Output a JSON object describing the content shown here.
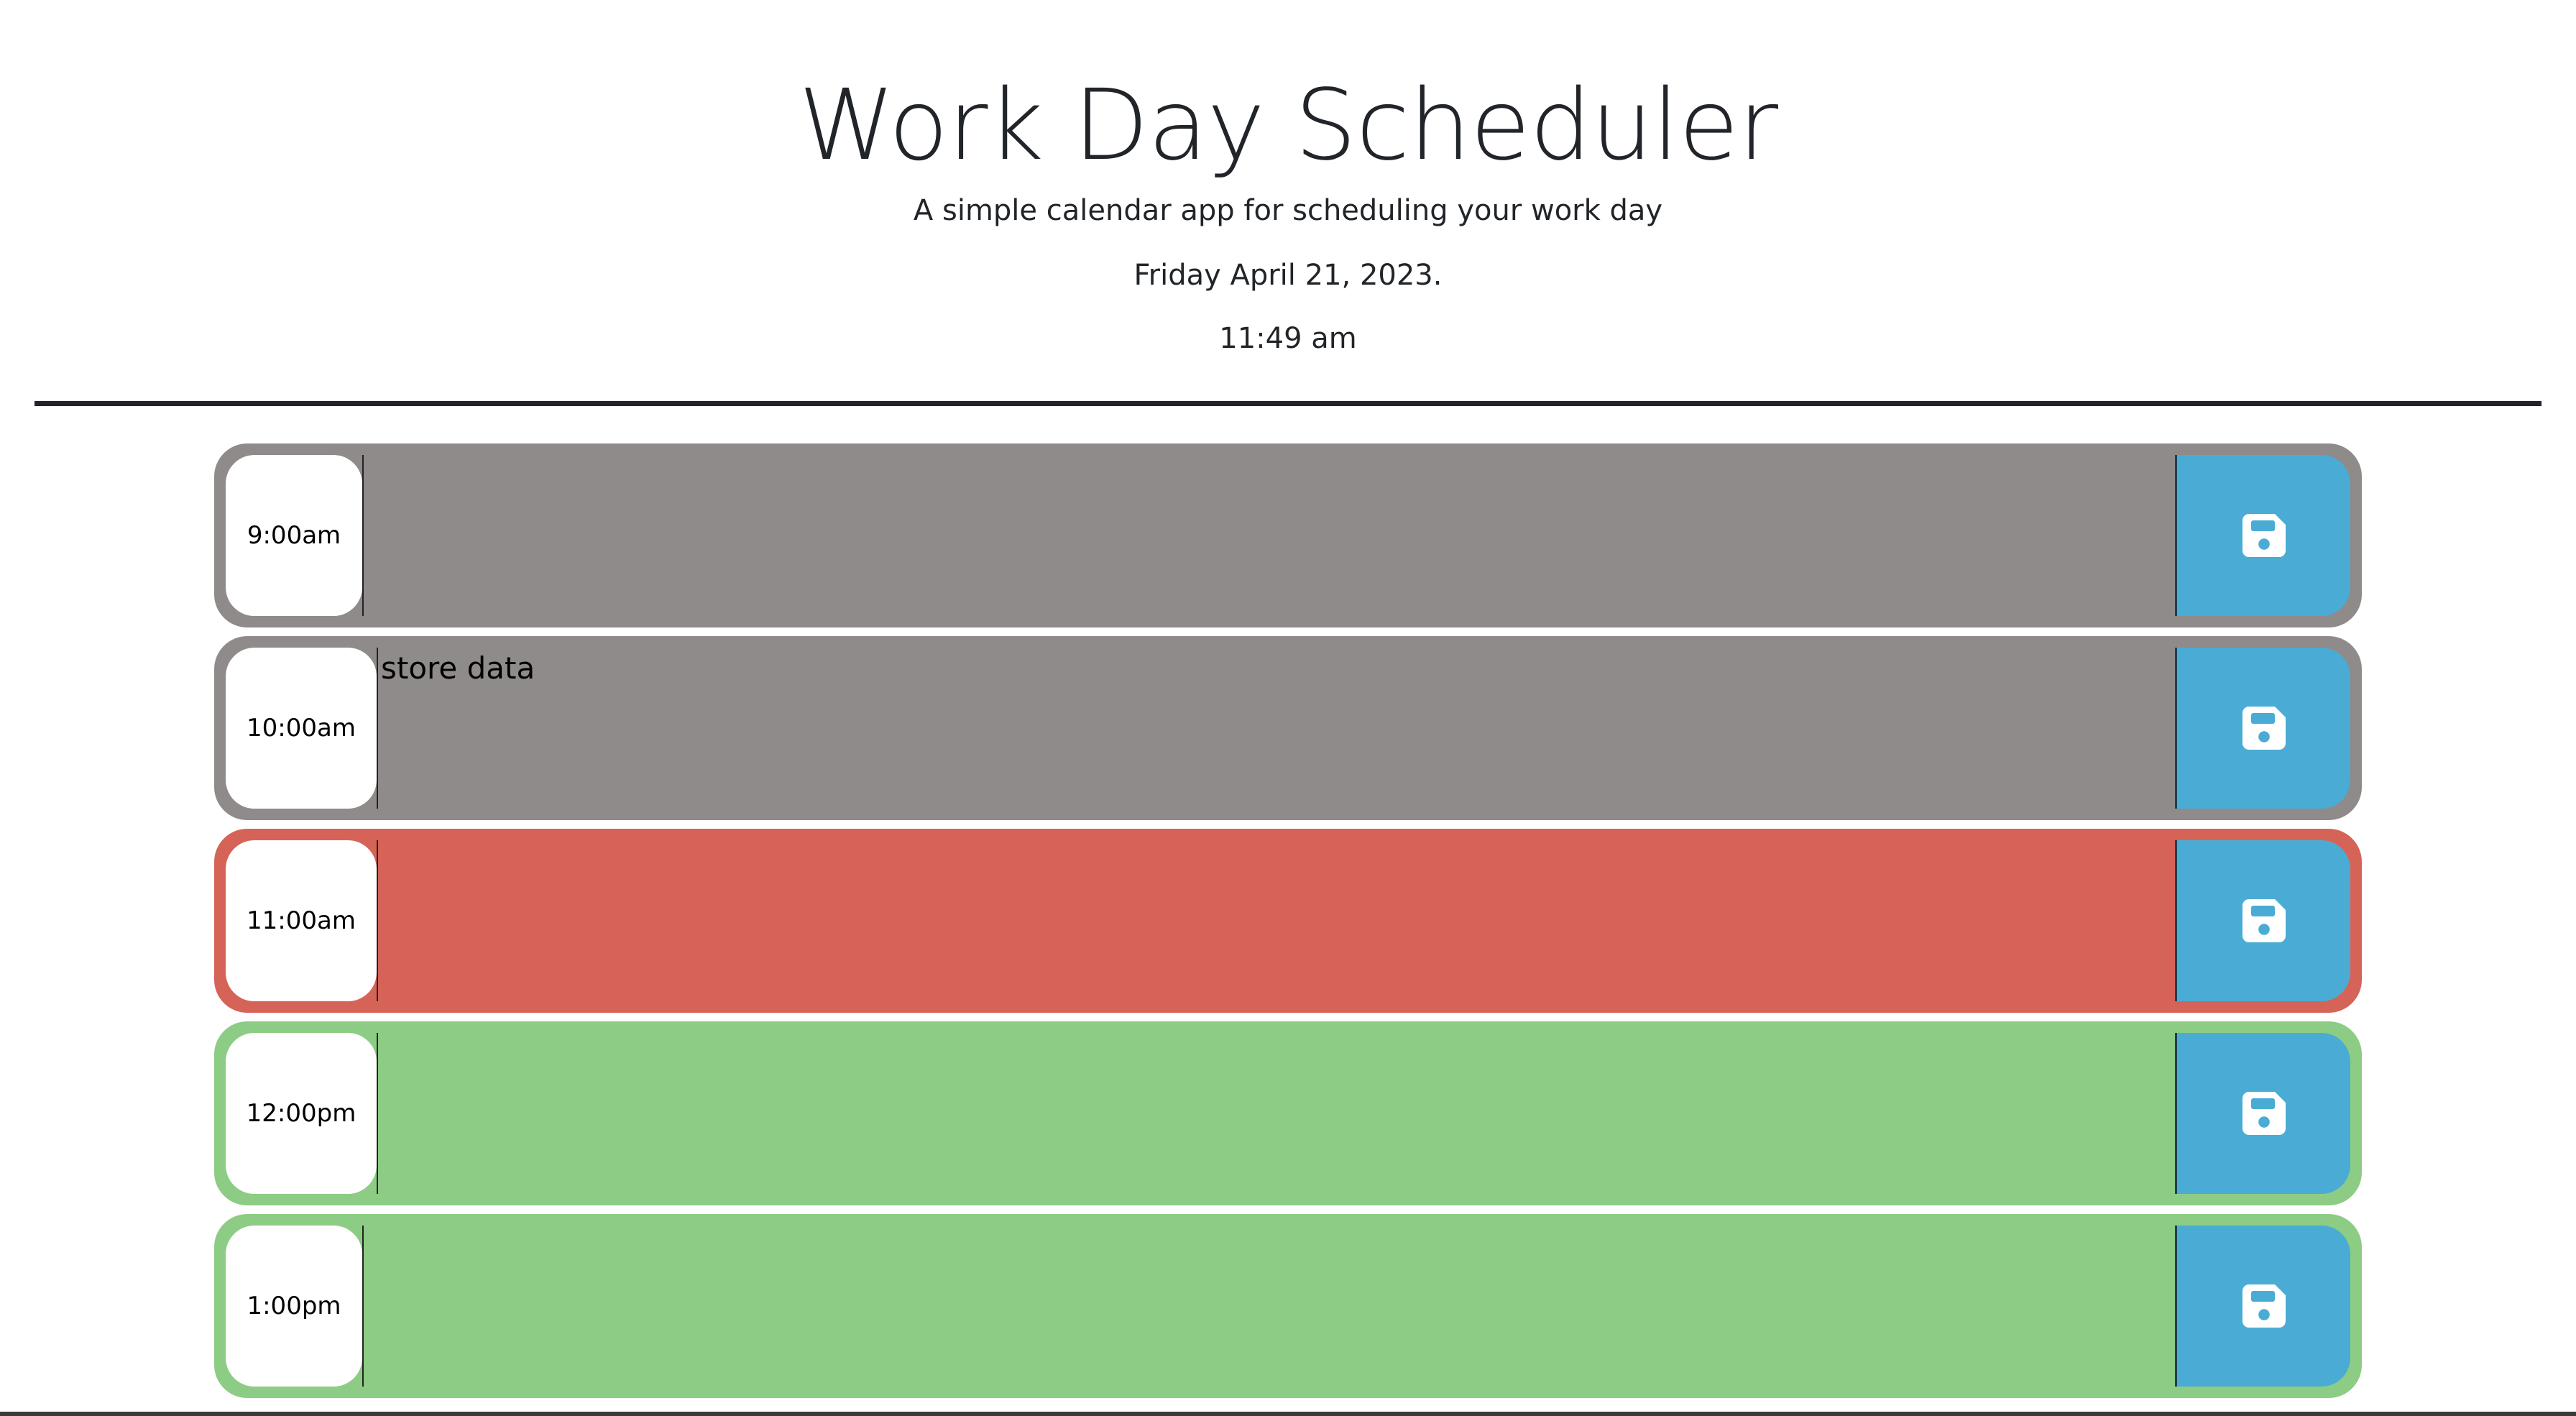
{
  "header": {
    "title": "Work Day Scheduler",
    "subtitle": "A simple calendar app for scheduling your work day",
    "date": "Friday April 21, 2023.",
    "time": "11:49 am"
  },
  "colors": {
    "past": "#8f8b8a",
    "present": "#d66358",
    "future": "#8dcc84",
    "save_button": "#4aacd4",
    "save_icon": "#ffffff"
  },
  "rows": [
    {
      "hour": "9:00am",
      "status": "past",
      "description": "",
      "save_icon": "floppy-disk-icon"
    },
    {
      "hour": "10:00am",
      "status": "past",
      "description": "store data",
      "save_icon": "floppy-disk-icon"
    },
    {
      "hour": "11:00am",
      "status": "present",
      "description": "",
      "save_icon": "floppy-disk-icon"
    },
    {
      "hour": "12:00pm",
      "status": "future",
      "description": "",
      "save_icon": "floppy-disk-icon"
    },
    {
      "hour": "1:00pm",
      "status": "future",
      "description": "",
      "save_icon": "floppy-disk-icon"
    }
  ]
}
